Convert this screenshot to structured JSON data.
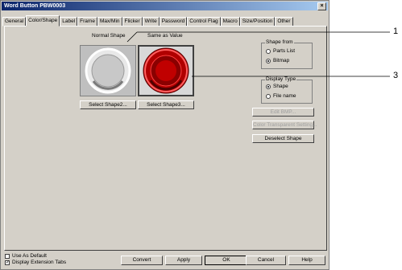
{
  "window": {
    "title": "Word Button  PBW0003",
    "close_glyph": "×"
  },
  "tabs": [
    "General",
    "Color/Shape",
    "Label",
    "Frame",
    "Max/Min",
    "Flicker",
    "Write",
    "Password",
    "Control Flag",
    "Macro",
    "Size/Position",
    "Other"
  ],
  "active_tab": "Color/Shape",
  "shapes": {
    "normal_label": "Normal Shape",
    "value_label": "Same as Value",
    "select_shape2": "Select Shape2...",
    "select_shape3": "Select Shape3..."
  },
  "shape_from": {
    "title": "Shape from",
    "options": [
      "Parts List",
      "Bitmap"
    ],
    "selected": "Bitmap"
  },
  "display_type": {
    "title": "Display Type",
    "options": [
      "Shape",
      "File name"
    ],
    "selected": "Shape"
  },
  "buttons": {
    "edit_bmp": "Edit BMP...",
    "color_transparent": "Color Transparent Setting...",
    "deselect_shape": "Deselect Shape"
  },
  "footer": {
    "use_as_default": "Use As Default",
    "use_as_default_checked": false,
    "display_extension_tabs": "Display Extension Tabs",
    "display_extension_tabs_checked": true,
    "convert": "Convert",
    "apply": "Apply",
    "ok": "OK",
    "cancel": "Cancel",
    "help": "Help"
  },
  "callouts": [
    "1",
    "3"
  ],
  "colors": {
    "title_bar": "#0a246a",
    "face": "#d4d0c8",
    "shape_normal": "#c0c0c0",
    "shape_value": "#c8101a"
  }
}
